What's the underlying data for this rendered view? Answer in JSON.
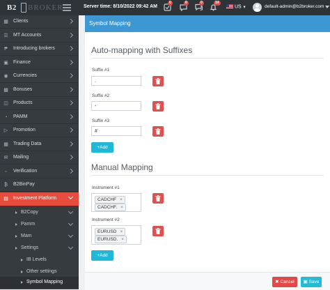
{
  "topbar": {
    "logo_left": "B2",
    "logo_right": "BROKER",
    "server_time_label": "Server time:",
    "server_time_value": "8/10/2022 09:42 AM",
    "badges": [
      "0",
      "0",
      "0",
      "14"
    ],
    "language": "US",
    "user_email": "default-admin@b2broker.com"
  },
  "sidebar": {
    "items": [
      {
        "label": "Clients",
        "icon": "clients-icon"
      },
      {
        "label": "MT Accounts",
        "icon": "list-icon"
      },
      {
        "label": "Introducing brokers",
        "icon": "ib-icon"
      },
      {
        "label": "Finance",
        "icon": "finance-icon"
      },
      {
        "label": "Currencies",
        "icon": "currencies-icon"
      },
      {
        "label": "Bonuses",
        "icon": "bonuses-icon"
      },
      {
        "label": "Products",
        "icon": "products-icon"
      },
      {
        "label": "PAMM",
        "icon": "pamm-icon"
      },
      {
        "label": "Promotion",
        "icon": "promotion-icon"
      },
      {
        "label": "Trading Data",
        "icon": "trading-data-icon"
      },
      {
        "label": "Mailing",
        "icon": "mailing-icon"
      },
      {
        "label": "Verification",
        "icon": "verification-icon"
      },
      {
        "label": "B2BinPay",
        "icon": "b2binpay-icon"
      },
      {
        "label": "Investment Platform",
        "icon": "investment-icon"
      }
    ],
    "subitems": [
      {
        "label": "B2Copy"
      },
      {
        "label": "Pamm"
      },
      {
        "label": "Mam"
      },
      {
        "label": "Settings"
      },
      {
        "label": "IB Levels"
      },
      {
        "label": "Other settings"
      },
      {
        "label": "Symbol Mapping"
      }
    ]
  },
  "main": {
    "panel_title": "Symbol Mapping",
    "auto_title": "Auto-mapping with Suffixes",
    "suffixes": [
      {
        "label": "Suffix #1",
        "value": "."
      },
      {
        "label": "Suffix #2",
        "value": "-"
      },
      {
        "label": "Suffix #3",
        "value": "#"
      }
    ],
    "add_label": "Add",
    "manual_title": "Manual Mapping",
    "instruments": [
      {
        "label": "Instrument #1",
        "tags": [
          "CADCHF",
          "CADCHF."
        ]
      },
      {
        "label": "Instrument #2",
        "tags": [
          "EURUSD",
          "EURUSD."
        ]
      }
    ],
    "cancel_label": "Cancel",
    "save_label": "Save"
  },
  "colors": {
    "accent_blue": "#3d97d3",
    "danger_red": "#e15050",
    "add_cyan": "#1fb8d8",
    "sidebar_bg": "#363b40",
    "topbar_bg": "#2e3338",
    "active_item": "#e74c3c"
  }
}
